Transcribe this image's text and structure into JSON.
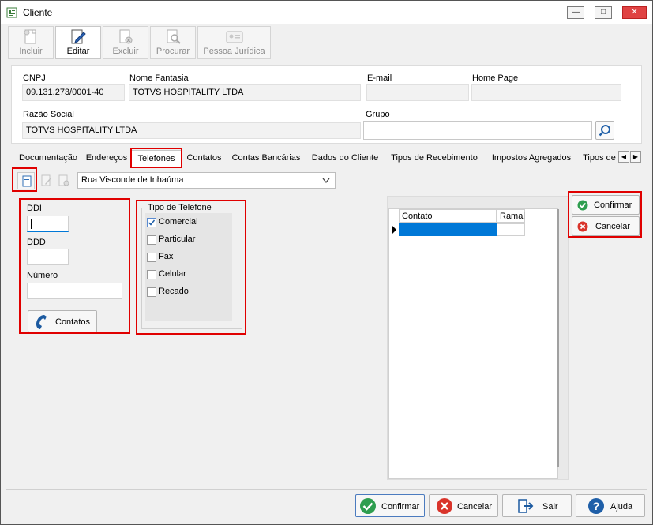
{
  "window": {
    "title": "Cliente"
  },
  "toolbar": [
    {
      "label": "Incluir",
      "icon": "new-document-icon"
    },
    {
      "label": "Editar",
      "icon": "edit-icon"
    },
    {
      "label": "Excluir",
      "icon": "delete-icon"
    },
    {
      "label": "Procurar",
      "icon": "search-document-icon"
    },
    {
      "label": "Pessoa Jurídica",
      "icon": "id-card-icon"
    }
  ],
  "form": {
    "cnpj_label": "CNPJ",
    "cnpj_value": "09.131.273/0001-40",
    "nome_fantasia_label": "Nome Fantasia",
    "nome_fantasia_value": "TOTVS HOSPITALITY LTDA",
    "email_label": "E-mail",
    "email_value": "",
    "homepage_label": "Home Page",
    "homepage_value": "",
    "razao_social_label": "Razão Social",
    "razao_social_value": "TOTVS HOSPITALITY LTDA",
    "grupo_label": "Grupo",
    "grupo_value": ""
  },
  "tabs": [
    "Documentação",
    "Endereços",
    "Telefones",
    "Contatos",
    "Contas Bancárias",
    "Dados do Cliente",
    "Tipos de Recebimento",
    "Impostos Agregados",
    "Tipos de"
  ],
  "selected_tab": "Telefones",
  "address_dropdown": "Rua Visconde de Inhaúma",
  "phone": {
    "ddi_label": "DDI",
    "ddd_label": "DDD",
    "numero_label": "Número",
    "contatos_button": "Contatos"
  },
  "tipo_telefone": {
    "title": "Tipo de Telefone",
    "options": [
      {
        "label": "Comercial",
        "checked": true
      },
      {
        "label": "Particular",
        "checked": false
      },
      {
        "label": "Fax",
        "checked": false
      },
      {
        "label": "Celular",
        "checked": false
      },
      {
        "label": "Recado",
        "checked": false
      }
    ]
  },
  "grid": {
    "columns": [
      "Contato",
      "Ramal"
    ]
  },
  "side_buttons": {
    "confirmar": "Confirmar",
    "cancelar": "Cancelar"
  },
  "footer": {
    "confirmar": "Confirmar",
    "cancelar": "Cancelar",
    "sair": "Sair",
    "ajuda": "Ajuda"
  },
  "colors": {
    "accent": "#0078d7",
    "highlight": "#e00000",
    "confirm": "#2e9e4f",
    "cancel": "#d9342b"
  }
}
